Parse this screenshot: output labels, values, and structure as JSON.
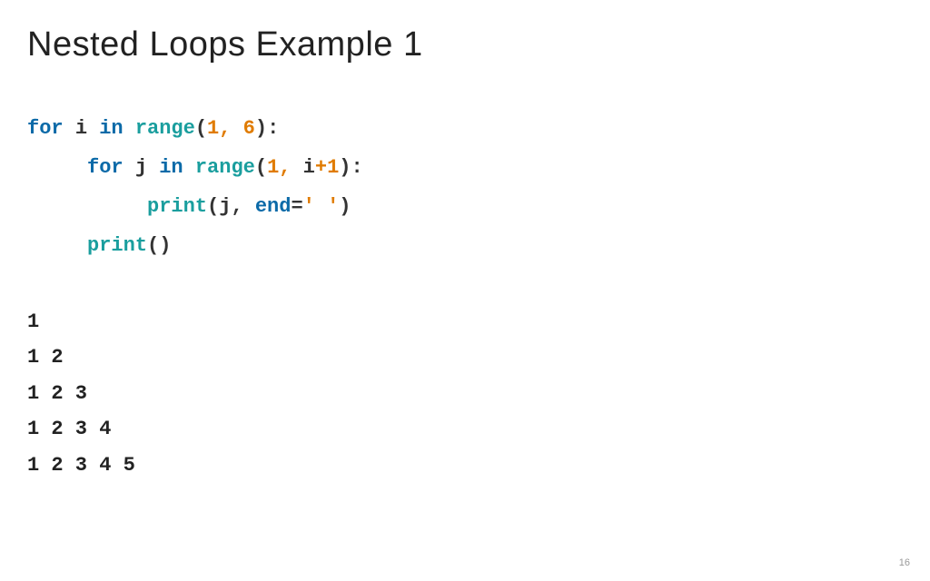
{
  "title": "Nested Loops Example 1",
  "code": {
    "line1": {
      "for": "for",
      "i": "i",
      "in": "in",
      "range": "range",
      "lp": "(",
      "arg1": "1",
      "comma": ", ",
      "arg2": "6",
      "rp": ")",
      "colon": ":"
    },
    "line2": {
      "for": "for",
      "j": "j",
      "in": "in",
      "range": "range",
      "lp": "(",
      "arg1": "1",
      "comma": ", ",
      "i": "i",
      "plus": "+",
      "one": "1",
      "rp": ")",
      "colon": ":"
    },
    "line3": {
      "print": "print",
      "lp": "(",
      "j": "j",
      "comma": ", ",
      "end": "end",
      "eq": "=",
      "quote": "' '",
      "rp": ")"
    },
    "line4": {
      "print": "print",
      "lp": "(",
      "rp": ")"
    }
  },
  "output": "1\n1 2\n1 2 3\n1 2 3 4\n1 2 3 4 5",
  "pageNumber": "16"
}
